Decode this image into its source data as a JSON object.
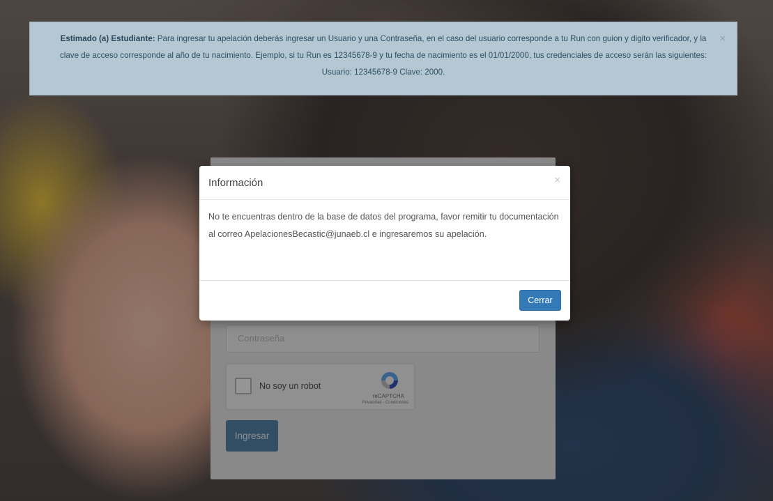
{
  "notice": {
    "bold_label": "Estimado (a) Estudiante:",
    "message": " Para ingresar tu apelación deberás ingresar un Usuario y una Contraseña, en el caso del usuario corresponde a tu Run con guion y digito verificador, y la clave de acceso corresponde al año de tu nacimiento. Ejemplo, si tu Run es 12345678-9 y tu fecha de nacimiento es el 01/01/2000, tus credenciales de acceso serán las siguientes: Usuario: 12345678-9 Clave: 2000.",
    "close_symbol": "×"
  },
  "login": {
    "password_placeholder": "Contraseña",
    "captcha_label": "No soy un robot",
    "captcha_brand": "reCAPTCHA",
    "captcha_terms": "Privacidad - Condiciones",
    "submit_label": "Ingresar"
  },
  "modal": {
    "title": "Información",
    "close_symbol": "×",
    "body": "No te encuentras dentro de la base de datos del programa, favor remitir tu documentación al correo ApelacionesBecastic@junaeb.cl e ingresaremos su apelación.",
    "close_button_label": "Cerrar"
  },
  "colors": {
    "primary_button": "#337ab7",
    "notice_background": "#b5c7d3",
    "notice_text": "#2c4f63"
  }
}
